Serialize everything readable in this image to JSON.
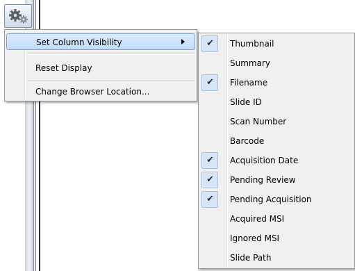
{
  "main_menu": {
    "items": [
      {
        "label": "Set Column Visibility",
        "has_submenu": true,
        "highlighted": true
      },
      {
        "label": "Reset Display"
      },
      {
        "label": "Change Browser Location..."
      }
    ]
  },
  "column_menu": {
    "items": [
      {
        "label": "Thumbnail",
        "checked": true
      },
      {
        "label": "Summary",
        "checked": false
      },
      {
        "label": "Filename",
        "checked": true
      },
      {
        "label": "Slide ID",
        "checked": false
      },
      {
        "label": "Scan Number",
        "checked": false
      },
      {
        "label": "Barcode",
        "checked": false
      },
      {
        "label": "Acquisition Date",
        "checked": true
      },
      {
        "label": "Pending Review",
        "checked": true
      },
      {
        "label": "Pending Acquisition",
        "checked": true
      },
      {
        "label": "Acquired MSI",
        "checked": false
      },
      {
        "label": "Ignored MSI",
        "checked": false
      },
      {
        "label": "Slide Path",
        "checked": false
      }
    ],
    "check_glyph": "✔"
  },
  "toolbar": {
    "settings_icon": "gears-icon"
  }
}
